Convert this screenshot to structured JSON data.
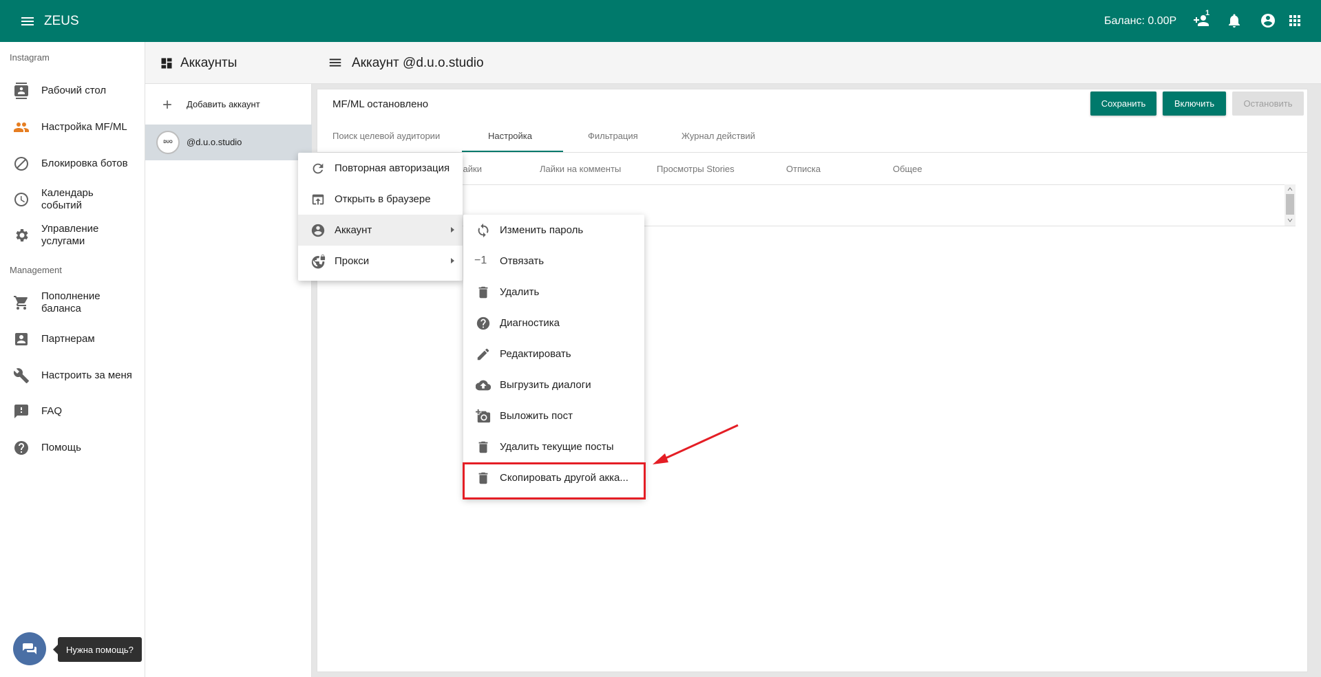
{
  "topbar": {
    "title": "ZEUS",
    "balance": "Баланс: 0.00Р",
    "badge_count": "1",
    "icons": [
      "menu-icon",
      "person-add-icon",
      "bell-icon",
      "account-circle-icon",
      "apps-icon"
    ],
    "color": "#00796b"
  },
  "sidebar": {
    "section1": "Instagram",
    "section2": "Management",
    "items": [
      {
        "label": "Рабочий стол",
        "icon": "contacts-icon"
      },
      {
        "label": "Настройка MF/ML",
        "icon": "people-icon",
        "color": "#e67e22"
      },
      {
        "label": "Блокировка ботов",
        "icon": "block-icon"
      },
      {
        "label": "Календарь\nсобытий",
        "icon": "clock-icon"
      },
      {
        "label": "Управление\nуслугами",
        "icon": "gear-icon"
      },
      {
        "label": "Пополнение\nбаланса",
        "icon": "cart-icon"
      },
      {
        "label": "Партнерам",
        "icon": "account-box-icon"
      },
      {
        "label": "Настроить за меня",
        "icon": "wrench-icon"
      },
      {
        "label": "FAQ",
        "icon": "feedback-icon"
      },
      {
        "label": "Помощь",
        "icon": "help-icon"
      }
    ]
  },
  "accounts": {
    "title": "Аккаунты",
    "add_label": "Добавить аккаунт",
    "account_name": "@d.u.o.studio",
    "avatar_text": "DUO"
  },
  "main": {
    "title": "Аккаунт @d.u.o.studio",
    "status": "MF/ML остановлено",
    "buttons": {
      "save": "Сохранить",
      "enable": "Включить",
      "stop": "Остановить"
    },
    "tabs": [
      "Поиск целевой аудитории",
      "Настройка",
      "Фильтрация",
      "Журнал действий"
    ],
    "active_tab": "Настройка",
    "subtabs": [
      "Лайки",
      "Лайки на комменты",
      "Просмотры Stories",
      "Отписка",
      "Общее"
    ]
  },
  "context_menu": {
    "items": [
      {
        "label": "Повторная авторизация",
        "icon": "refresh-icon"
      },
      {
        "label": "Открыть в браузере",
        "icon": "open-in-browser-icon"
      },
      {
        "label": "Аккаунт",
        "icon": "account-circle-icon"
      },
      {
        "label": "Прокси",
        "icon": "vpn-lock-icon"
      }
    ]
  },
  "submenu": {
    "items": [
      {
        "label": "Изменить пароль",
        "icon": "sync-icon"
      },
      {
        "label": "Отвязать",
        "icon": "minus-one-icon"
      },
      {
        "label": "Удалить",
        "icon": "trash-icon"
      },
      {
        "label": "Диагностика",
        "icon": "help-icon"
      },
      {
        "label": "Редактировать",
        "icon": "pencil-icon"
      },
      {
        "label": "Выгрузить диалоги",
        "icon": "cloud-upload-icon"
      },
      {
        "label": "Выложить пост",
        "icon": "add-photo-icon"
      },
      {
        "label": "Удалить текущие посты",
        "icon": "trash-icon"
      },
      {
        "label": "Скопировать другой акка...",
        "icon": "trash-icon"
      }
    ],
    "icon_minus_one": "−1"
  },
  "chat": {
    "tooltip": "Нужна помощь?"
  },
  "colors": {
    "primary": "#00796b",
    "annotation": "#e41e25"
  }
}
